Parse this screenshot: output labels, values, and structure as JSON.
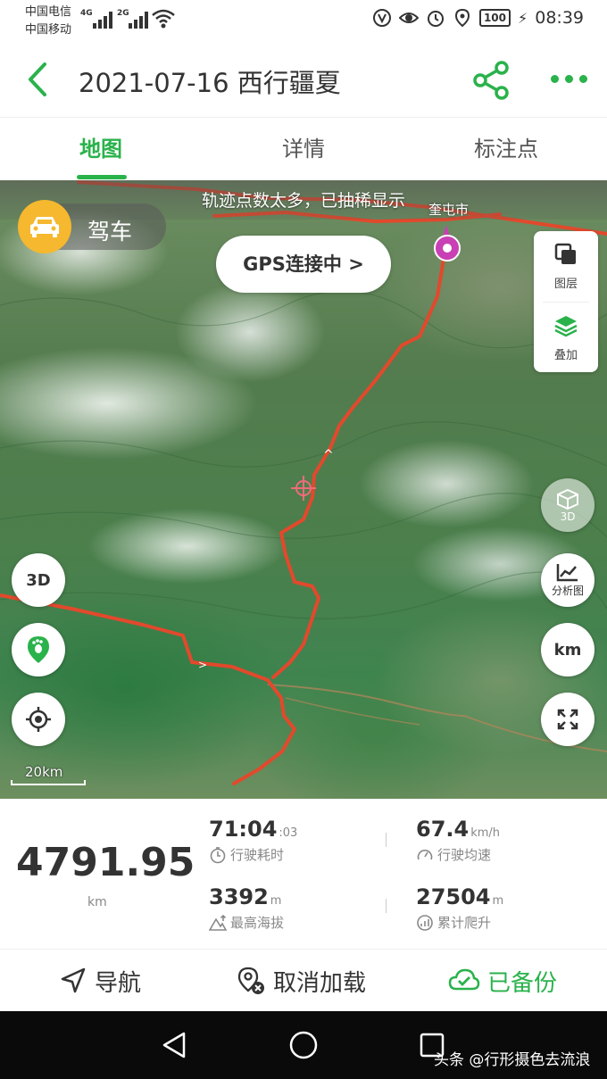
{
  "status_bar": {
    "carrier1": "中国电信",
    "carrier2": "中国移动",
    "sig1_type": "4G",
    "sig2_type": "2G",
    "battery": "100",
    "time": "08:39"
  },
  "header": {
    "title": "2021-07-16 西行疆夏",
    "back_icon": "chevron-left-icon",
    "share_icon": "share-icon",
    "more_icon": "more-dots-icon",
    "accent_color": "#2ab24b"
  },
  "tabs": [
    {
      "label": "地图",
      "active": true
    },
    {
      "label": "详情",
      "active": false
    },
    {
      "label": "标注点",
      "active": false
    }
  ],
  "map": {
    "banner": "轨迹点数太多，已抽稀显示",
    "city_label": "奎屯市",
    "mode_label": "驾车",
    "gps_status": "GPS连接中 >",
    "layer_label": "图层",
    "overlay_label": "叠加",
    "btn_3d_left": "3D",
    "btn_3d_right": "3D",
    "btn_analysis": "分析图",
    "btn_unit": "km",
    "scale_label": "20km",
    "track_color": "#e2492c"
  },
  "stats": {
    "total_distance": "4791.95",
    "total_unit": "km",
    "drive_time_main": "71:04",
    "drive_time_sec": ":03",
    "drive_time_label": "行驶耗时",
    "avg_speed": "67.4",
    "avg_speed_unit": "km/h",
    "avg_speed_label": "行驶均速",
    "max_altitude": "3392",
    "max_altitude_unit": "m",
    "max_altitude_label": "最高海拔",
    "total_climb": "27504",
    "total_climb_unit": "m",
    "total_climb_label": "累计爬升"
  },
  "actions": {
    "navigate": "导航",
    "cancel_load": "取消加载",
    "backed_up": "已备份"
  },
  "watermark": "头条 @行形摄色去流浪"
}
